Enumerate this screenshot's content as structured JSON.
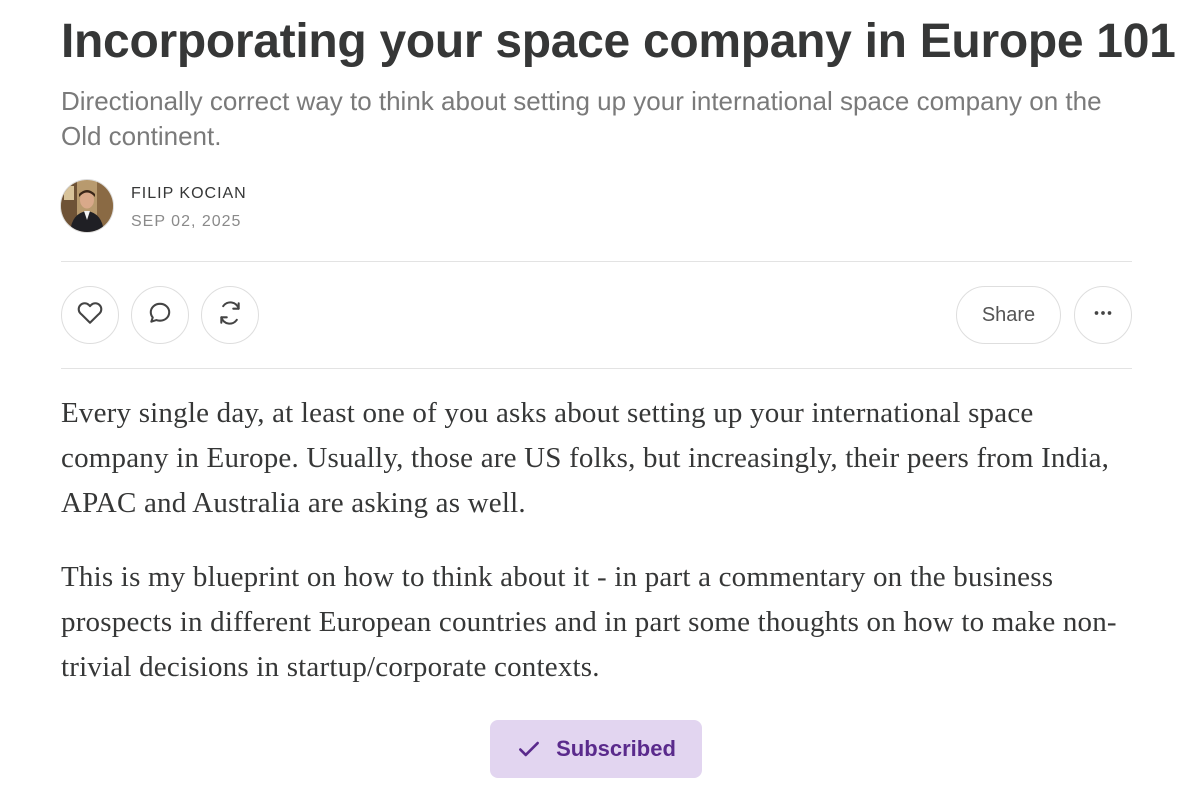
{
  "article": {
    "title": "Incorporating your space company in Europe 101",
    "subtitle": "Directionally correct way to think about setting up your international space company on the Old continent.",
    "author": "FILIP KOCIAN",
    "date": "SEP 02, 2025"
  },
  "actions": {
    "share_label": "Share",
    "icons": [
      "heart-icon",
      "comment-icon",
      "restack-icon",
      "more-icon"
    ]
  },
  "body": {
    "paragraphs": [
      "Every single day, at least one of you asks about setting up your international space company in Europe. Usually, those are US folks, but increasingly, their peers from India, APAC and Australia are asking as well.",
      "This is my blueprint on how to think about it - in part a commentary on the business prospects in different European countries and in part some thoughts on how to make non-trivial decisions in startup/corporate contexts."
    ]
  },
  "subscribe": {
    "label": "Subscribed",
    "icon": "check-icon",
    "background": "#e2d5f0",
    "text_color": "#5a2a8c"
  },
  "colors": {
    "text": "#363737",
    "muted": "#7a7a7a",
    "border": "#dedede"
  }
}
